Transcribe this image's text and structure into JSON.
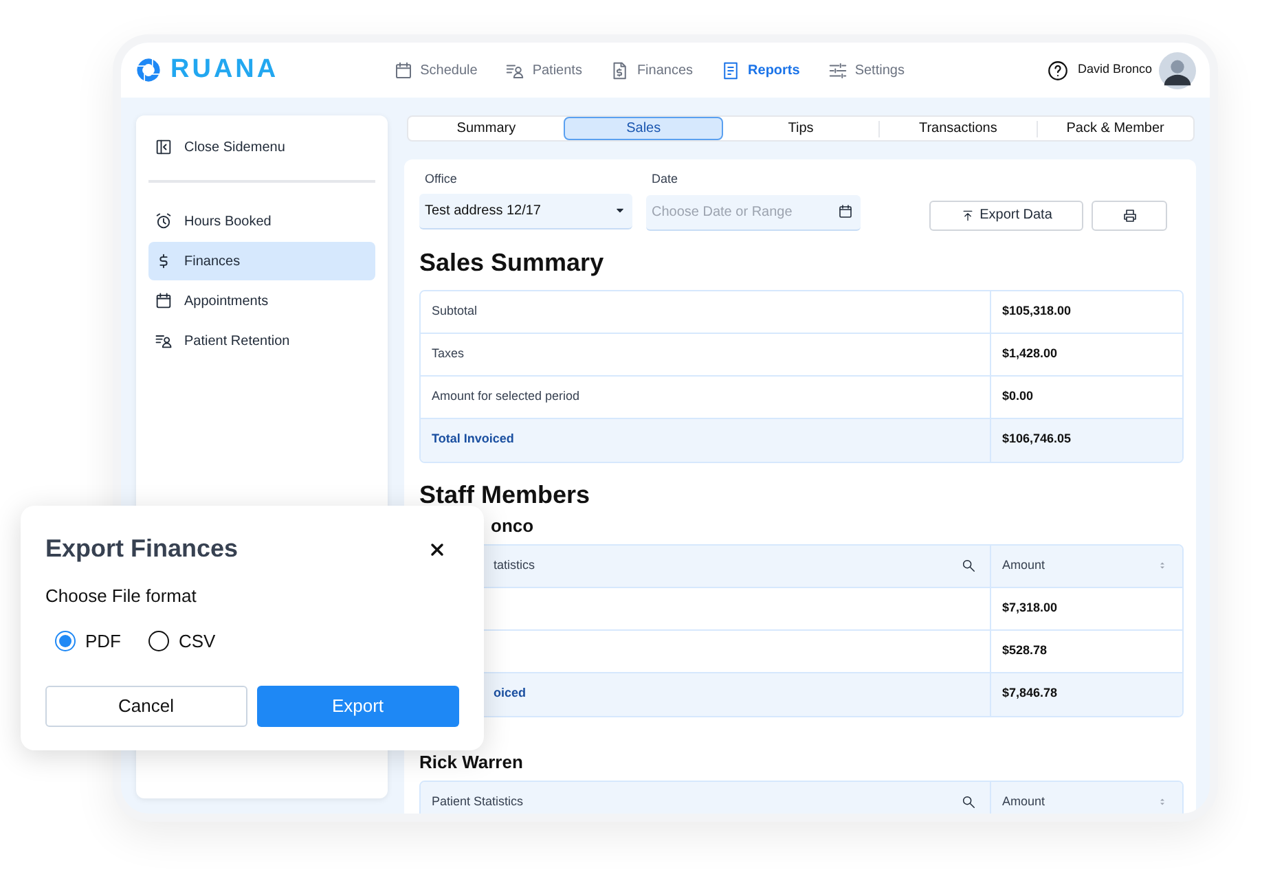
{
  "header": {
    "logo": "RUANA",
    "nav": [
      {
        "label": "Schedule",
        "kind": "calendar",
        "selected": false
      },
      {
        "label": "Patients",
        "kind": "patients",
        "selected": false
      },
      {
        "label": "Finances",
        "kind": "invoice",
        "selected": false
      },
      {
        "label": "Reports",
        "kind": "report",
        "selected": true
      },
      {
        "label": "Settings",
        "kind": "sliders",
        "selected": false
      }
    ],
    "user": "David Bronco"
  },
  "sidebar": {
    "close_label": "Close Sidemenu",
    "items": [
      {
        "label": "Hours Booked",
        "kind": "alarm",
        "selected": false
      },
      {
        "label": "Finances",
        "kind": "dollar",
        "selected": true
      },
      {
        "label": "Appointments",
        "kind": "calendar",
        "selected": false
      },
      {
        "label": "Patient Retention",
        "kind": "patients",
        "selected": false
      }
    ]
  },
  "tabs": [
    {
      "label": "Summary",
      "selected": false
    },
    {
      "label": "Sales",
      "selected": true
    },
    {
      "label": "Tips",
      "selected": false
    },
    {
      "label": "Transactions",
      "selected": false
    },
    {
      "label": "Pack & Member",
      "selected": false
    }
  ],
  "filters": {
    "office": {
      "label": "Office",
      "value": "Test address 12/17"
    },
    "date": {
      "label": "Date",
      "placeholder": "Choose Date or Range"
    }
  },
  "export_button": "Export Data",
  "sales_summary": {
    "title": "Sales Summary",
    "rows": [
      {
        "label": "Subtotal",
        "amount": "$105,318.00",
        "total": false
      },
      {
        "label": "Taxes",
        "amount": "$1,428.00",
        "total": false
      },
      {
        "label": "Amount for selected period",
        "amount": "$0.00",
        "total": false
      },
      {
        "label": "Total Invoiced",
        "amount": "$106,746.05",
        "total": true
      }
    ]
  },
  "staff": {
    "title": "Staff Members",
    "members": [
      {
        "name": "onco",
        "covered": true,
        "columns": [
          "tatistics",
          "Amount"
        ],
        "rows": [
          {
            "amount": "$7,318.00",
            "total": false
          },
          {
            "amount": "$528.78",
            "total": false
          },
          {
            "label": "oiced",
            "amount": "$7,846.78",
            "total": true
          }
        ]
      },
      {
        "name": "Rick Warren",
        "covered": false,
        "columns": [
          "Patient Statistics",
          "Amount"
        ]
      }
    ]
  },
  "dialog": {
    "title": "Export Finances",
    "prompt": "Choose File format",
    "options": [
      {
        "label": "PDF",
        "selected": true
      },
      {
        "label": "CSV",
        "selected": false
      }
    ],
    "cancel": "Cancel",
    "confirm": "Export"
  }
}
